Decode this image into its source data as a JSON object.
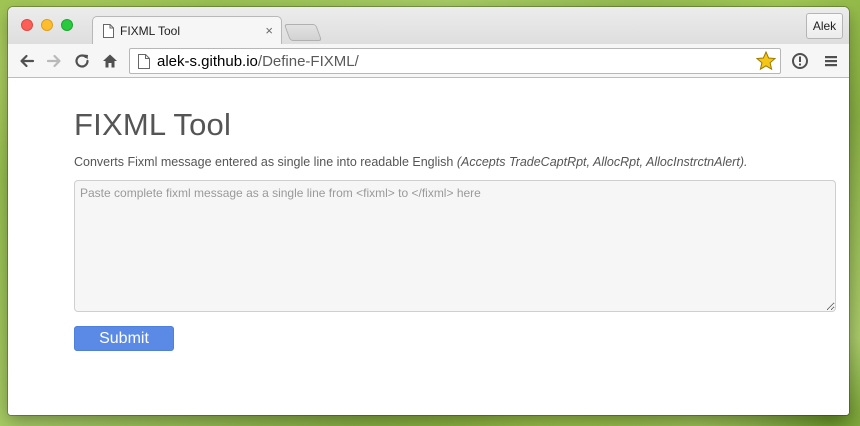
{
  "browser": {
    "tab": {
      "title": "FIXML Tool",
      "close_glyph": "×"
    },
    "profile_name": "Alek",
    "address": {
      "host": "alek-s.github.io",
      "path": "/Define-FIXML/"
    },
    "icons": {
      "back": "arrow-left-icon",
      "forward": "arrow-right-icon",
      "reload": "reload-icon",
      "home": "home-icon",
      "bookmark": "star-icon",
      "extension": "exclamation-circle-icon",
      "menu": "hamburger-menu-icon"
    },
    "colors": {
      "traffic_red": "#fc5f57",
      "traffic_yellow": "#fdbd2e",
      "traffic_green": "#29c940",
      "star": "#f5c518"
    }
  },
  "page": {
    "title": "FIXML Tool",
    "description": "Converts Fixml message entered as single line into readable English ",
    "description_note": "(Accepts TradeCaptRpt, AllocRpt, AllocInstrctnAlert).",
    "input": {
      "placeholder": "Paste complete fixml message as a single line from <fixml> to </fixml> here",
      "value": ""
    },
    "submit_label": "Submit",
    "colors": {
      "submit_bg": "#5a8ae6",
      "text": "#555555"
    }
  }
}
